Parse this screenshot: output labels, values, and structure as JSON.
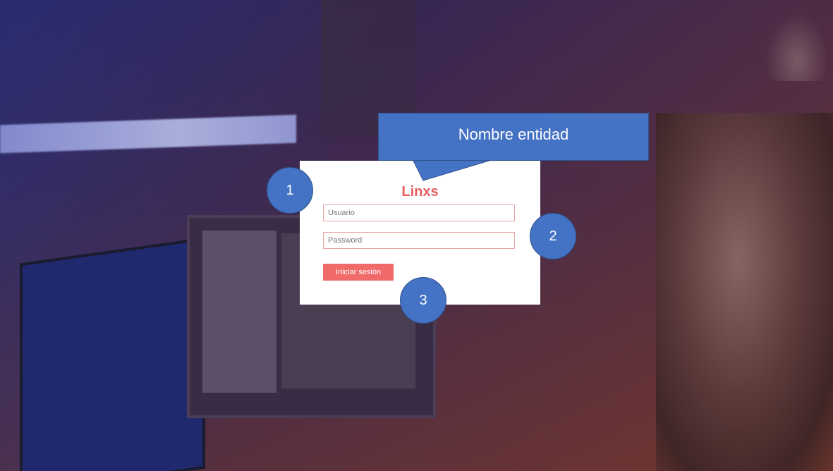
{
  "login": {
    "brand": "Linxs",
    "username_placeholder": "Usuario",
    "password_placeholder": "Password",
    "submit_label": "Iniciar sesión"
  },
  "callout": {
    "text": "Nombre entidad"
  },
  "markers": [
    "1",
    "2",
    "3"
  ],
  "colors": {
    "accent_red": "#e85f5f",
    "button_red": "#f06a6a",
    "field_border": "#e9a3a3",
    "callout_blue": "#4472c4"
  },
  "icons": []
}
